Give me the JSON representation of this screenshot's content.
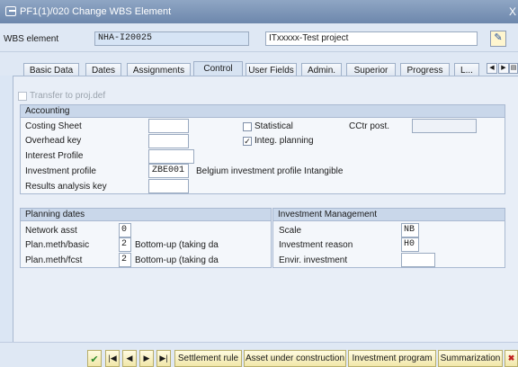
{
  "window": {
    "title": "PF1(1)/020 Change WBS Element",
    "close": "X"
  },
  "header": {
    "wbs_label": "WBS element",
    "wbs_value": "NHA-I20025",
    "wbs_desc": "ITxxxxx-Test project"
  },
  "tabs": [
    "Basic Data",
    "Dates",
    "Assignments",
    "Control",
    "User Fields",
    "Admin.",
    "Superior",
    "Progress",
    "L..."
  ],
  "active_tab": "Control",
  "transfer": {
    "label": "Transfer to proj.def"
  },
  "accounting": {
    "title": "Accounting",
    "costing_sheet": "Costing Sheet",
    "overhead_key": "Overhead key",
    "interest_profile": "Interest Profile",
    "investment_profile": "Investment profile",
    "investment_profile_value": "ZBE001",
    "investment_profile_desc": "Belgium investment profile Intangible",
    "results_analysis_key": "Results analysis key",
    "statistical": "Statistical",
    "cctr_post": "CCtr post.",
    "integ_planning": "Integ. planning"
  },
  "planning_dates": {
    "title": "Planning dates",
    "network_asst": "Network asst",
    "network_asst_value": "0",
    "plan_meth_basic": "Plan.meth/basic",
    "plan_meth_basic_value": "2",
    "plan_meth_basic_desc": "Bottom-up (taking da",
    "plan_meth_fcst": "Plan.meth/fcst",
    "plan_meth_fcst_value": "2",
    "plan_meth_fcst_desc": "Bottom-up (taking da"
  },
  "investment_mgmt": {
    "title": "Investment Management",
    "scale": "Scale",
    "scale_value": "NB",
    "investment_reason": "Investment reason",
    "investment_reason_value": "H0",
    "envir_investment": "Envir. investment"
  },
  "footer": {
    "settlement_rule": "Settlement rule",
    "asset_under_construction": "Asset under construction",
    "investment_program": "Investment program",
    "summarization": "Summarization"
  }
}
